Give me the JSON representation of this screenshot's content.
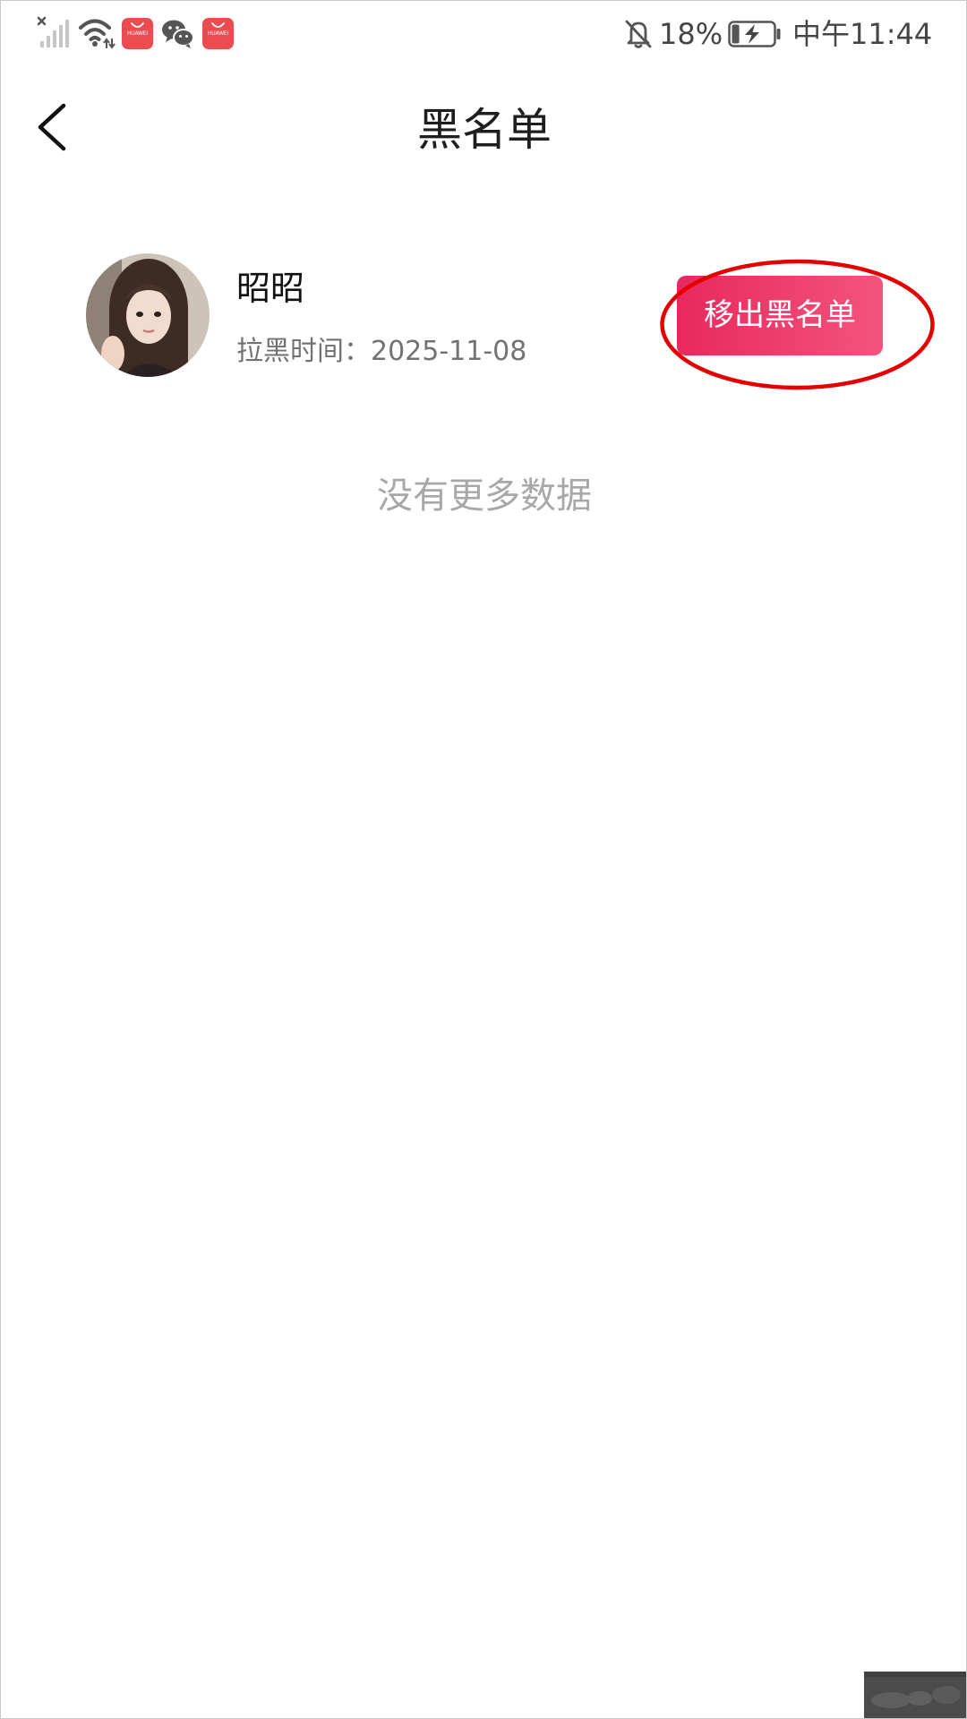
{
  "status_bar": {
    "time": "中午11:44",
    "battery_percent": "18%",
    "battery_charging": true,
    "logo_text": "HUAWEI",
    "left_icons": [
      "signal-no-service-icon",
      "wifi-icon",
      "huawei-appgallery-icon",
      "wechat-icon",
      "huawei-appgallery-icon"
    ],
    "right_icons": [
      "bell-off-icon",
      "battery-charging-icon"
    ]
  },
  "header": {
    "back_icon": "chevron-left-icon",
    "title": "黑名单"
  },
  "blacklist": {
    "items": [
      {
        "avatar_icon": "avatar-photo",
        "name": "昭昭",
        "blocked_time_label": "拉黑时间：",
        "blocked_date": "2025-11-08",
        "action_label": "移出黑名单"
      }
    ],
    "end_text": "没有更多数据"
  },
  "colors": {
    "accent_start": "#e8285e",
    "accent_end": "#f3547d",
    "annotation": "#e50000",
    "title_text": "#1e1e1e",
    "secondary_text": "#727272",
    "muted_text": "#a8a8a8"
  }
}
